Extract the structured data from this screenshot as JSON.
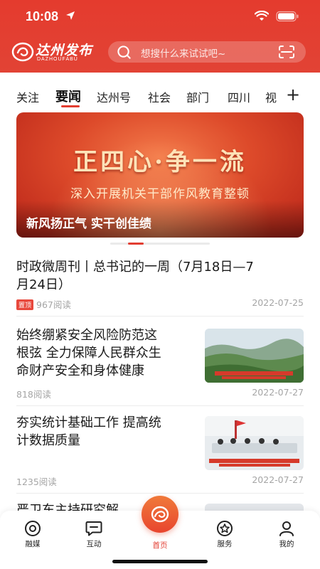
{
  "status_bar": {
    "time": "10:08"
  },
  "header": {
    "logo_cn": "达州发布",
    "logo_en": "DAZHOUFABU",
    "search_placeholder": "想搜什么来试试吧~"
  },
  "tabs": [
    {
      "label": "关注"
    },
    {
      "label": "要闻",
      "active": true
    },
    {
      "label": "达州号"
    },
    {
      "label": "社会"
    },
    {
      "label": "部门"
    },
    {
      "label": "四川"
    },
    {
      "label": "视"
    }
  ],
  "tab_add": "+",
  "banner": {
    "headline": "正四心·争一流",
    "subline": "深入开展机关干部作风教育整顿",
    "caption": "新风扬正气 实干创佳绩"
  },
  "articles": [
    {
      "title_line1": "时政微周刊丨总书记的一周（7月18日—7",
      "title_line2": "月24日）",
      "pin": "置顶",
      "reads": "967阅读",
      "date": "2022-07-25"
    },
    {
      "title_line1": "始终绷紧安全风险防范这",
      "title_line2": "根弦 全力保障人民群众生",
      "title_line3": "命财产安全和身体健康",
      "reads": "818阅读",
      "date": "2022-07-27"
    },
    {
      "title_line1": "夯实统计基础工作 提高统",
      "title_line2": "计数据质量",
      "reads": "1235阅读",
      "date": "2022-07-27"
    },
    {
      "title_line1": "严卫东主持研究解"
    }
  ],
  "bottom_nav": [
    {
      "label": "融媒",
      "icon": "eye-icon"
    },
    {
      "label": "互动",
      "icon": "chat-icon"
    },
    {
      "label": "首页",
      "icon": "home-logo-icon",
      "active": true
    },
    {
      "label": "服务",
      "icon": "service-icon"
    },
    {
      "label": "我的",
      "icon": "user-icon"
    }
  ],
  "colors": {
    "brand_red": "#e23d31",
    "accent_orange": "#f07a3a"
  }
}
